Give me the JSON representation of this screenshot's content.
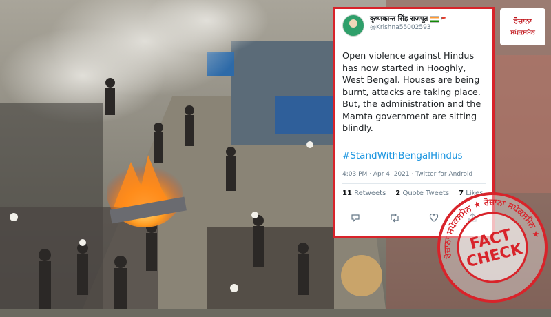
{
  "tweet": {
    "display_name": "कृष्णकान्त सिंह राजपूत",
    "handle": "@Krishna55002593",
    "text": "Open violence against Hindus has now started in Hooghly, West Bengal. Houses are being burnt, attacks are taking place. But, the administration and the Mamta government are sitting blindly.",
    "hashtag": "#StandWithBengalHindus",
    "meta": "4:03 PM · Apr 4, 2021 · Twitter for Android",
    "retweets_count": "11",
    "retweets_label": "Retweets",
    "quotes_count": "2",
    "quotes_label": "Quote Tweets",
    "likes_count": "7",
    "likes_label": "Likes",
    "icons": [
      "reply-icon",
      "retweet-icon",
      "like-icon",
      "share-icon"
    ]
  },
  "logo": {
    "line1": "ਰੋਜ਼ਾਨਾ",
    "line2": "ਸਪੋਕਸਮੈਨ"
  },
  "stamp": {
    "center_line1": "FACT",
    "center_line2": "CHECK",
    "ring_text": "ਰੋਜ਼ਾਨਾ ਸਪੋਕਸਮੈਨ ★ ਰੋਜ਼ਾਨਾ ਸਪੋਕਸਮੈਨ ★",
    "color": "#d8232a"
  }
}
